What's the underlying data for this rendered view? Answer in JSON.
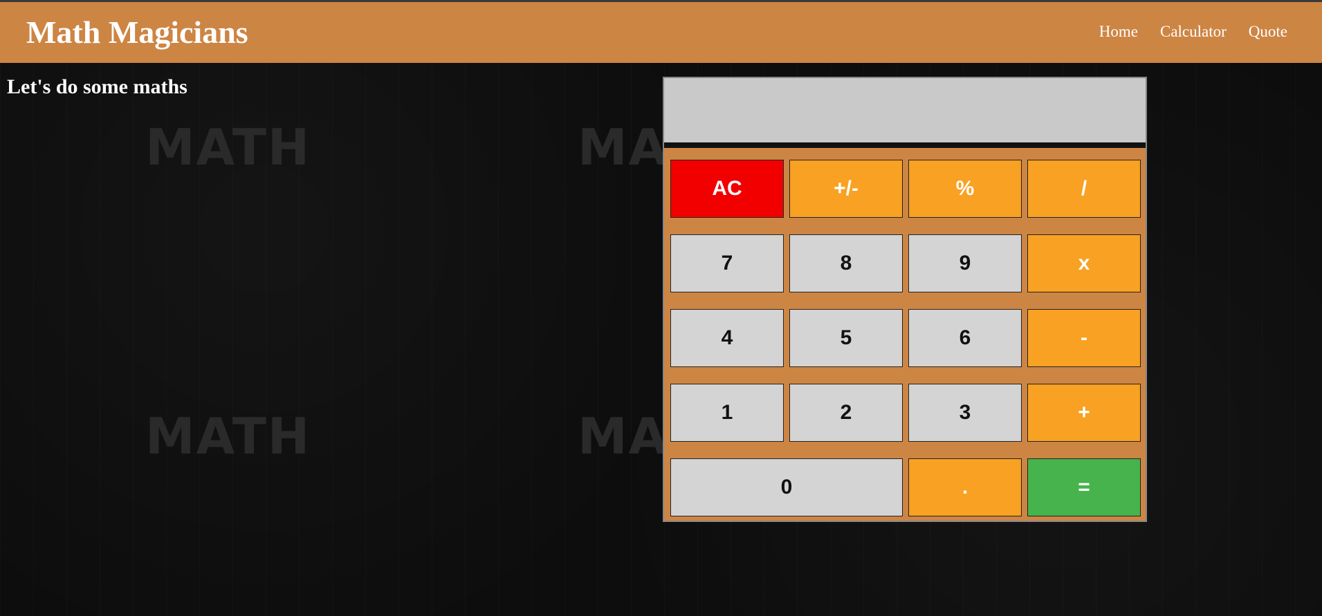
{
  "header": {
    "brand": "Math Magicians",
    "nav": [
      "Home",
      "Calculator",
      "Quote"
    ]
  },
  "page": {
    "heading": "Let's do some maths"
  },
  "background": {
    "watermark_text": "MATH"
  },
  "calculator": {
    "display_value": "",
    "keys": {
      "ac": "AC",
      "sign": "+/-",
      "percent": "%",
      "divide": "/",
      "seven": "7",
      "eight": "8",
      "nine": "9",
      "multiply": "x",
      "four": "4",
      "five": "5",
      "six": "6",
      "minus": "-",
      "one": "1",
      "two": "2",
      "three": "3",
      "plus": "+",
      "zero": "0",
      "dot": ".",
      "equals": "="
    }
  },
  "colors": {
    "header_bg": "#cd8544",
    "operator": "#f8a122",
    "clear": "#f20000",
    "equals": "#47b34c",
    "number": "#d4d4d4",
    "display": "#c9c9c9"
  }
}
